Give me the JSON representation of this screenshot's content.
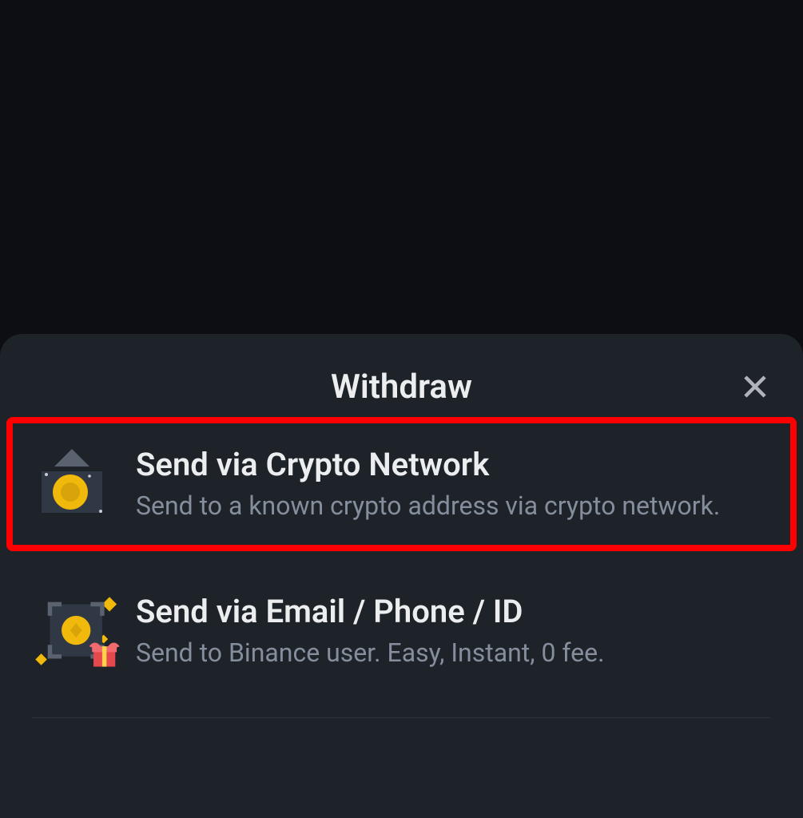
{
  "sheet": {
    "title": "Withdraw"
  },
  "options": [
    {
      "title": "Send via Crypto Network",
      "desc": "Send to a known crypto address via crypto network."
    },
    {
      "title": "Send via Email / Phone / ID",
      "desc": "Send to Binance user. Easy, Instant, 0 fee."
    }
  ]
}
